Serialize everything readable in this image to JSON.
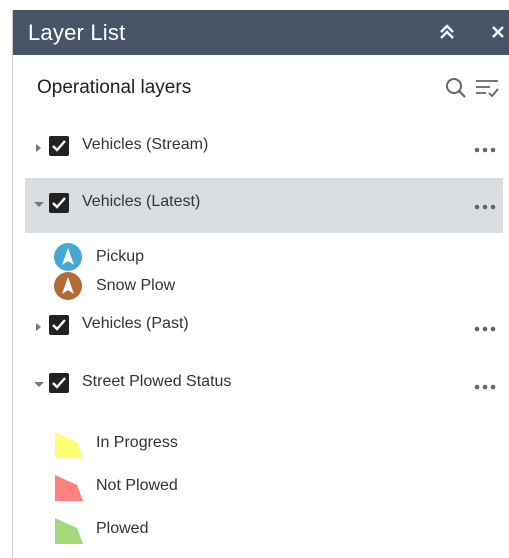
{
  "header": {
    "title": "Layer List"
  },
  "panel": {
    "subtitle": "Operational layers"
  },
  "layers": [
    {
      "label": "Vehicles (Stream)",
      "expanded": false,
      "checked": true,
      "selected": false
    },
    {
      "label": "Vehicles (Latest)",
      "expanded": true,
      "checked": true,
      "selected": true,
      "legend": [
        {
          "label": "Pickup",
          "symbol": "navigation-arrow-icon",
          "color": "#45a8d4"
        },
        {
          "label": "Snow Plow",
          "symbol": "navigation-arrow-icon",
          "color": "#b26b34"
        }
      ]
    },
    {
      "label": "Vehicles (Past)",
      "expanded": false,
      "checked": true,
      "selected": false
    },
    {
      "label": "Street Plowed Status",
      "expanded": true,
      "checked": true,
      "selected": false,
      "legend": [
        {
          "label": "In Progress",
          "symbol": "polygon-swatch",
          "color": "#ffff73"
        },
        {
          "label": "Not Plowed",
          "symbol": "polygon-swatch",
          "color": "#ff7f7f"
        },
        {
          "label": "Plowed",
          "symbol": "polygon-swatch",
          "color": "#a3d97a"
        }
      ]
    }
  ],
  "colors": {
    "header_bg": "#485566",
    "header_text": "#ffffff",
    "selected_row": "#d9dde1",
    "checkbox": "#222222"
  }
}
